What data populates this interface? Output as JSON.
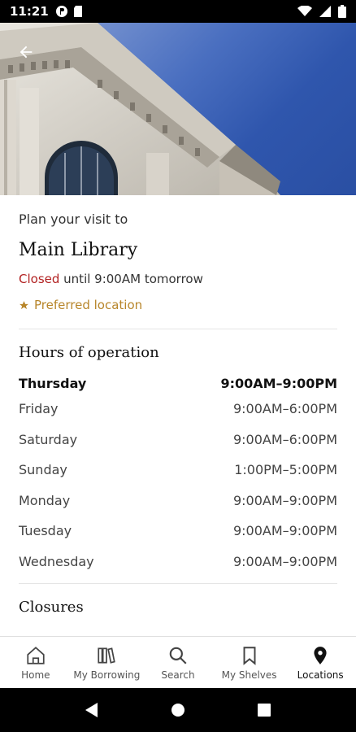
{
  "status_bar": {
    "time": "11:21"
  },
  "header": {
    "subtitle": "Plan your visit to",
    "title": "Main Library"
  },
  "status": {
    "state": "Closed",
    "detail": "until 9:00AM tomorrow",
    "preferred": "Preferred location"
  },
  "hours": {
    "title": "Hours of operation",
    "rows": [
      {
        "day": "Thursday",
        "time": "9:00AM–9:00PM"
      },
      {
        "day": "Friday",
        "time": "9:00AM–6:00PM"
      },
      {
        "day": "Saturday",
        "time": "9:00AM–6:00PM"
      },
      {
        "day": "Sunday",
        "time": "1:00PM–5:00PM"
      },
      {
        "day": "Monday",
        "time": "9:00AM–9:00PM"
      },
      {
        "day": "Tuesday",
        "time": "9:00AM–9:00PM"
      },
      {
        "day": "Wednesday",
        "time": "9:00AM–9:00PM"
      }
    ]
  },
  "closures": {
    "title": "Closures"
  },
  "nav": {
    "items": [
      {
        "label": "Home",
        "icon": "home-icon"
      },
      {
        "label": "My Borrowing",
        "icon": "books-icon"
      },
      {
        "label": "Search",
        "icon": "search-icon"
      },
      {
        "label": "My Shelves",
        "icon": "bookmark-icon"
      },
      {
        "label": "Locations",
        "icon": "location-pin-icon"
      }
    ]
  },
  "colors": {
    "closed": "#b22222",
    "preferred": "#b8862b"
  }
}
